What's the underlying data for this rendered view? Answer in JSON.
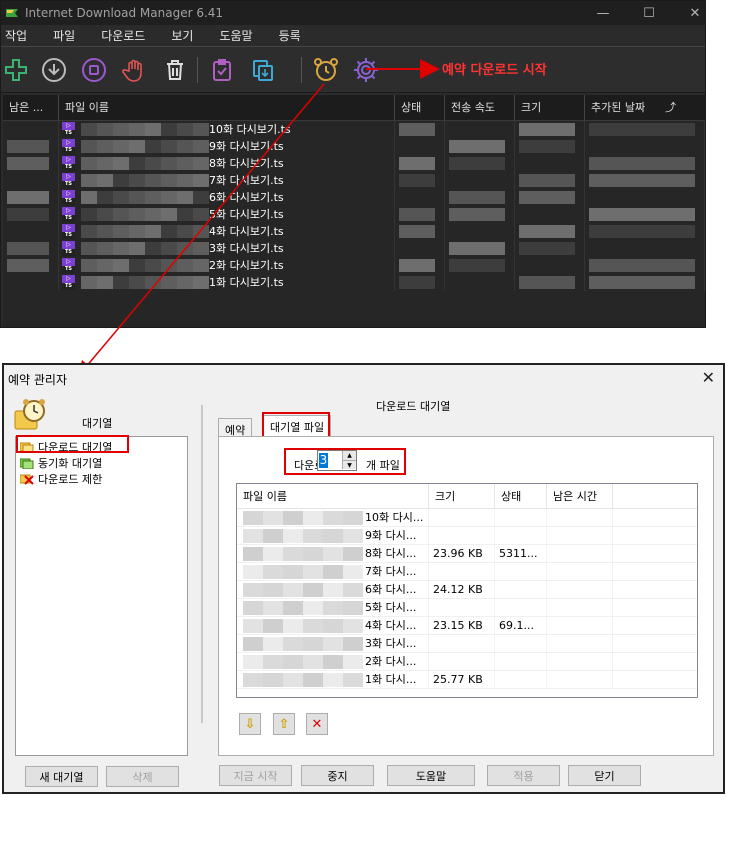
{
  "idm": {
    "title": "Internet Download Manager 6.41",
    "window_controls": {
      "minimize": "—",
      "maximize": "☐",
      "close": "✕"
    },
    "menu": [
      "작업",
      "파일",
      "다운로드",
      "보기",
      "도움말",
      "등록"
    ],
    "annotation": "예약 다운로드 시작",
    "columns": [
      "남은 ...",
      "파일 이름",
      "상태",
      "전송 속도",
      "크기",
      "추가된 날짜"
    ],
    "sort_indicator": "⤴",
    "files": [
      {
        "name": "10화 다시보기.ts",
        "icon_top": "▷",
        "icon_bottom": "TS"
      },
      {
        "name": "9화 다시보기.ts",
        "icon_top": "▷",
        "icon_bottom": "TS"
      },
      {
        "name": "8화 다시보기.ts",
        "icon_top": "▷",
        "icon_bottom": "TS"
      },
      {
        "name": "7화 다시보기.ts",
        "icon_top": "▷",
        "icon_bottom": "TS"
      },
      {
        "name": "6화 다시보기.ts",
        "icon_top": "▷",
        "icon_bottom": "TS"
      },
      {
        "name": "5화 다시보기.ts",
        "icon_top": "▷",
        "icon_bottom": "TS"
      },
      {
        "name": "4화 다시보기.ts",
        "icon_top": "▷",
        "icon_bottom": "TS"
      },
      {
        "name": "3화 다시보기.ts",
        "icon_top": "▷",
        "icon_bottom": "TS"
      },
      {
        "name": "2화 다시보기.ts",
        "icon_top": "▷",
        "icon_bottom": "TS"
      },
      {
        "name": "1화 다시보기.ts",
        "icon_top": "▷",
        "icon_bottom": "TS"
      }
    ]
  },
  "scheduler": {
    "title": "예약 관리자",
    "close": "✕",
    "queues_label": "대기열",
    "queues": [
      "다운로드 대기열",
      "동기화 대기열",
      "다운로드 제한"
    ],
    "right_title": "다운로드 대기열",
    "tabs": [
      "예약",
      "대기열 파일"
    ],
    "download_label": "다운로드",
    "concurrent_value": "3",
    "spin_up": "▲",
    "spin_down": "▼",
    "files_suffix": "개 파일",
    "table_columns": [
      "파일 이름",
      "크기",
      "상태",
      "남은 시간"
    ],
    "queue_files": [
      {
        "name": "10화 다시...",
        "size": "",
        "status": ""
      },
      {
        "name": "9화 다시...",
        "size": "",
        "status": ""
      },
      {
        "name": "8화 다시...",
        "size": "23.96  KB",
        "status": "5311..."
      },
      {
        "name": "7화 다시...",
        "size": "",
        "status": ""
      },
      {
        "name": "6화 다시...",
        "size": "24.12  KB",
        "status": ""
      },
      {
        "name": "5화 다시...",
        "size": "",
        "status": ""
      },
      {
        "name": "4화 다시...",
        "size": "23.15  KB",
        "status": "69.1..."
      },
      {
        "name": "3화 다시...",
        "size": "",
        "status": ""
      },
      {
        "name": "2화 다시...",
        "size": "",
        "status": ""
      },
      {
        "name": "1화 다시...",
        "size": "25.77  KB",
        "status": ""
      }
    ],
    "small_buttons": {
      "down": "⇩",
      "up": "⇧",
      "delete": "✕"
    },
    "buttons": {
      "new_queue": "새 대기열",
      "delete": "삭제",
      "start_now": "지금 시작",
      "stop": "중지",
      "help": "도움말",
      "apply": "적용",
      "close": "닫기"
    }
  },
  "colors": {
    "annotation_red": "#e00000",
    "idm_bg": "#2b2b2b",
    "ts_purple": "#7b3fd1"
  }
}
